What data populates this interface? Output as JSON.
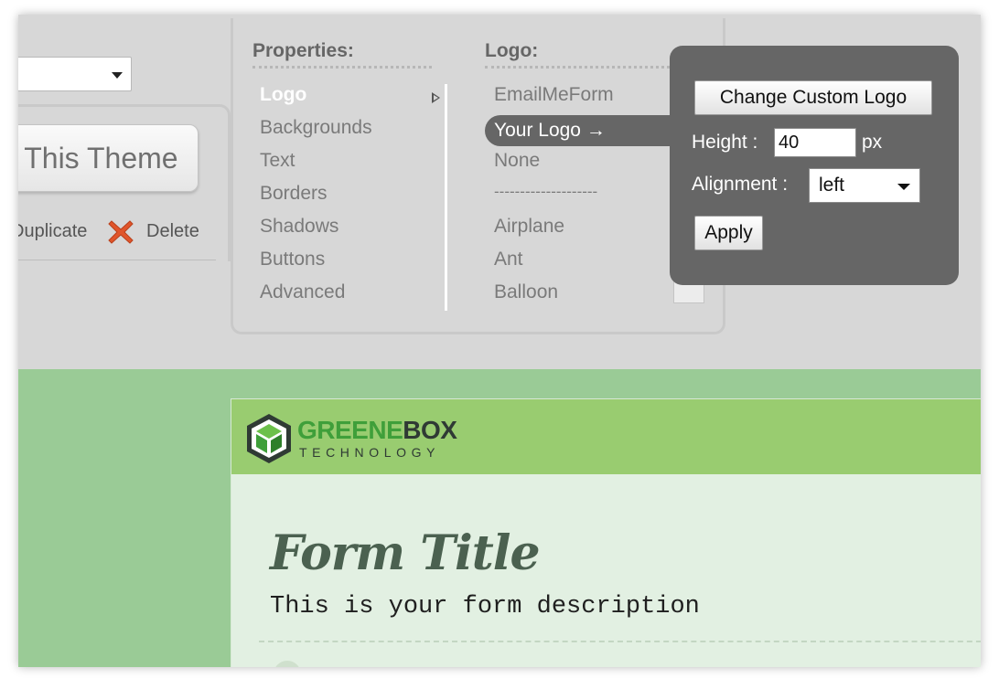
{
  "theme_panel": {
    "use_theme_label": "Use This Theme",
    "duplicate_label": "Duplicate",
    "delete_label": "Delete"
  },
  "properties": {
    "heading": "Properties:",
    "items": [
      "Logo",
      "Backgrounds",
      "Text",
      "Borders",
      "Shadows",
      "Buttons",
      "Advanced"
    ],
    "active": "Logo"
  },
  "logo_options": {
    "heading": "Logo:",
    "items": [
      "EmailMeForm",
      "Your Logo →",
      "None",
      "--------------------",
      "Airplane",
      "Ant",
      "Balloon"
    ],
    "selected": "Your Logo →"
  },
  "custom_logo_popover": {
    "change_button": "Change Custom Logo",
    "height_label": "Height :",
    "height_value": "40",
    "height_unit": "px",
    "alignment_label": "Alignment :",
    "alignment_value": "left",
    "apply_button": "Apply"
  },
  "form_preview": {
    "brand_part1": "GREENE",
    "brand_part2": "BOX",
    "brand_tagline": "TECHNOLOGY",
    "title": "Form Title",
    "description": "This is your form description"
  },
  "colors": {
    "toolbar_bg": "#d7d7d7",
    "popover_bg": "#666666",
    "preview_bg": "#9acb96",
    "header_bg": "#99cc70",
    "card_bg": "#e2f0e2",
    "delete_red": "#e0552b"
  },
  "icons": {
    "delete": "x-icon",
    "logo_mark": "cube-hexagon-icon"
  }
}
